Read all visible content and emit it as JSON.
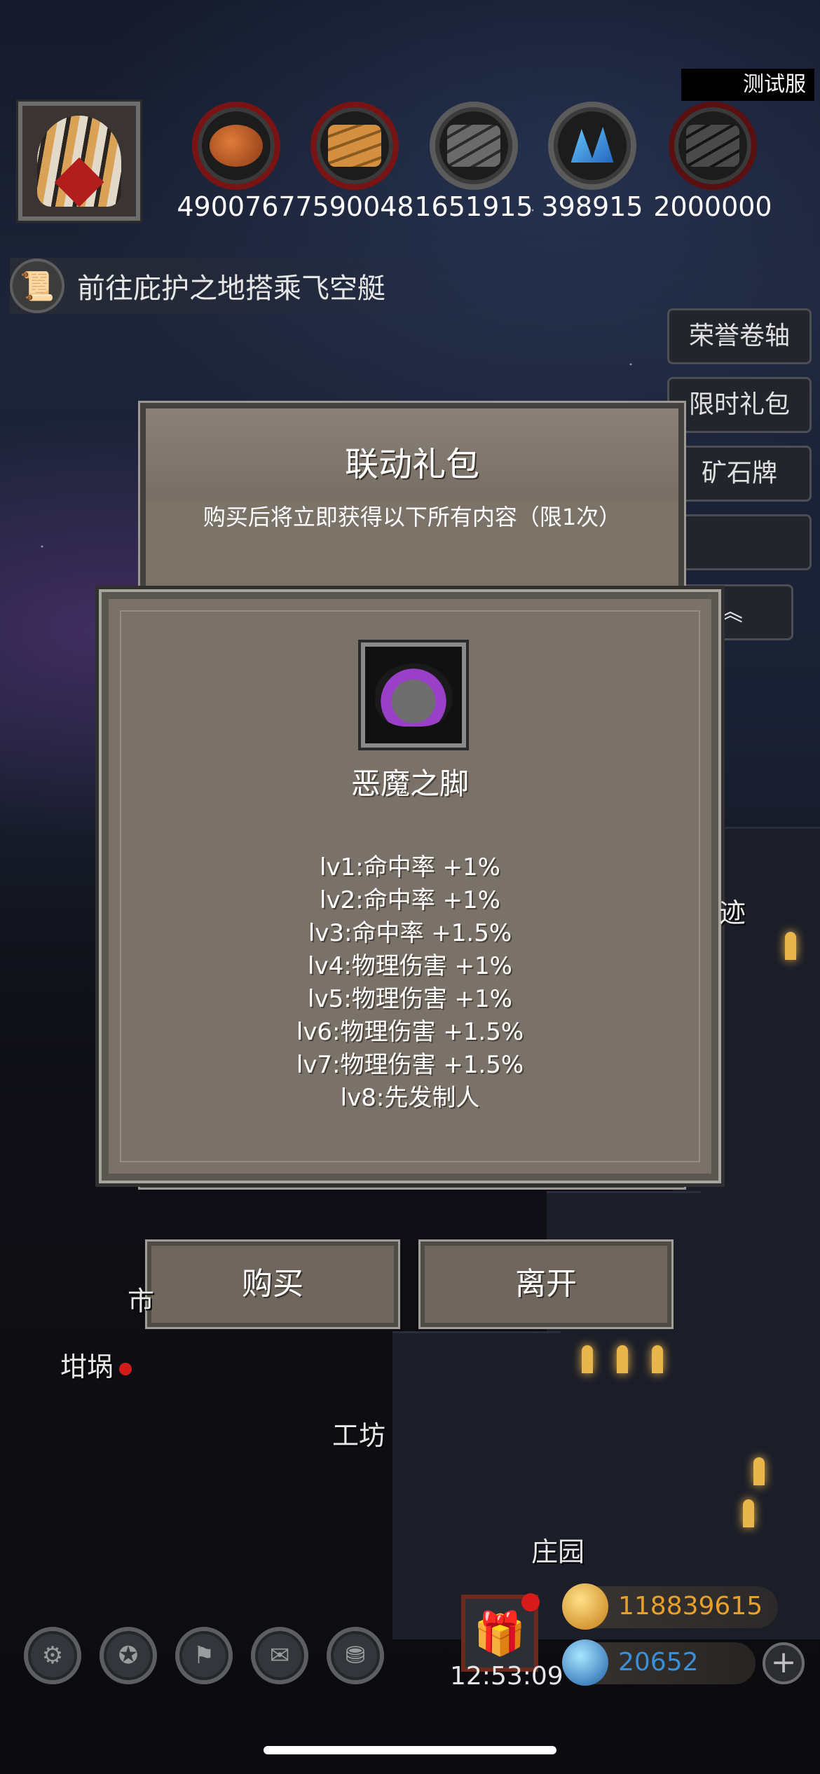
{
  "server_tag": "测试服",
  "resources": [
    {
      "icon": "meat-icon",
      "value": "4900767"
    },
    {
      "icon": "wood-icon",
      "value": "7590048"
    },
    {
      "icon": "iron-icon",
      "value": "1651915"
    },
    {
      "icon": "crystal-icon",
      "value": "398915"
    },
    {
      "icon": "ore-icon",
      "value": "2000000"
    }
  ],
  "quest": {
    "text": "前往庇护之地搭乘飞空艇"
  },
  "side_menu": [
    "荣誉卷轴",
    "限时礼包",
    "矿石牌"
  ],
  "back_dialog": {
    "title": "联动礼包",
    "subtitle": "购买后将立即获得以下所有内容（限1次）"
  },
  "item": {
    "name": "恶魔之脚",
    "levels": [
      "lv1:命中率 +1%",
      "lv2:命中率 +1%",
      "lv3:命中率 +1.5%",
      "lv4:物理伤害 +1%",
      "lv5:物理伤害 +1%",
      "lv6:物理伤害 +1.5%",
      "lv7:物理伤害 +1.5%",
      "lv8:先发制人"
    ]
  },
  "buttons": {
    "buy": "购买",
    "leave": "离开"
  },
  "map_labels": {
    "market": "市",
    "ruins": "迹",
    "fort": "坩埚",
    "workshop": "工坊",
    "manor": "庄园"
  },
  "clock": "12:53:09",
  "currency": {
    "gold": "118839615",
    "gems": "20652"
  },
  "colors": {
    "gold": "#e8a02a",
    "gems": "#3a8fd8",
    "alert": "#d11c1c"
  }
}
